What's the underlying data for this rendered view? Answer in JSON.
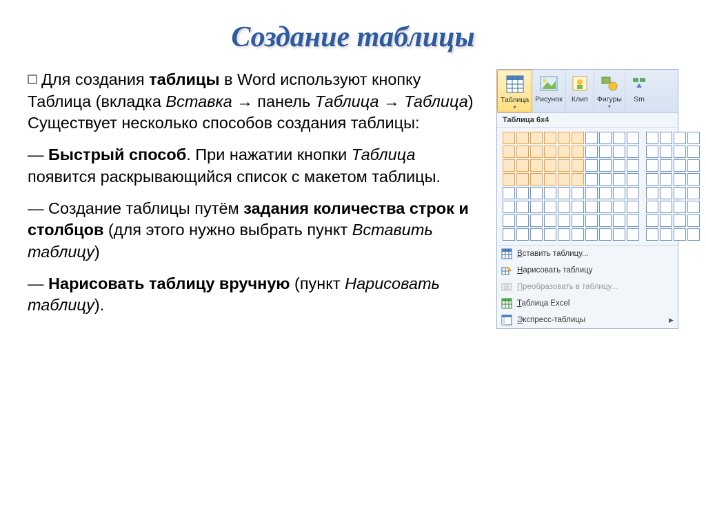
{
  "title": "Создание таблицы",
  "para1": {
    "t1": "Для создания ",
    "t2": "таблицы",
    "t3": " в Word используют кнопку Таблица (вкладка ",
    "t4": "Вставка",
    "t5": " → панель ",
    "t6": "Таблица",
    "t7": " → ",
    "t8": "Таблица",
    "t9": ") Существует несколько способов создания таблицы:"
  },
  "para2": {
    "t1": "— ",
    "t2": "Быстрый способ",
    "t3": ". При нажатии кнопки ",
    "t4": "Таблица",
    "t5": " появится раскрывающийся список с макетом таблицы."
  },
  "para3": {
    "t1": "— Создание таблицы путём ",
    "t2": "задания количества строк и столбцов",
    "t3": " (для этого нужно выбрать пункт ",
    "t4": "Вставить таблицу",
    "t5": ")"
  },
  "para4": {
    "t1": "— ",
    "t2": "Нарисовать таблицу вручную",
    "t3": " (пункт ",
    "t4": "Нарисовать таблицу",
    "t5": ")."
  },
  "ribbon": {
    "table": "Таблица",
    "picture": "Рисунок",
    "clip": "Клип",
    "shapes": "Фигуры",
    "smart": "Sm"
  },
  "dropdown": {
    "header": "Таблица 6x4",
    "insert": "Вставить таблицу...",
    "draw": "Нарисовать таблицу",
    "convert": "Преобразовать в таблицу...",
    "excel": "Таблица Excel",
    "express": "Экспресс-таблицы"
  }
}
